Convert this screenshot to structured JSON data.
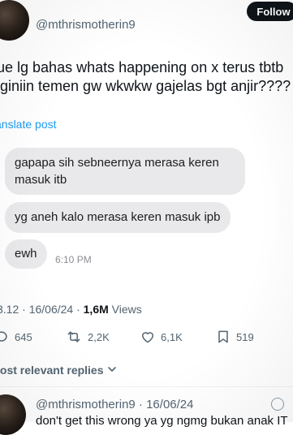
{
  "header": {
    "handle": "@mthrismotherin9",
    "follow_label": "Follow"
  },
  "post": {
    "line1": "ue lg bahas whats happening on x terus tbtb",
    "line2": "iginiin temen gw wkwkw gajelas bgt anjir????",
    "translate": "anslate post"
  },
  "chat": {
    "bubble1_line1": "gapapa sih sebneernya merasa keren",
    "bubble1_line2": "masuk itb",
    "bubble2": "yg aneh kalo merasa keren masuk ipb",
    "bubble3": "ewh",
    "time": "6:10 PM"
  },
  "meta": {
    "time_date": "3.12 · 16/06/24 · ",
    "views_count": "1,6M",
    "views_label": " Views"
  },
  "actions": {
    "replies": "645",
    "reposts": "2,2K",
    "likes": "6,1K",
    "bookmarks": "519"
  },
  "replies_sort": {
    "label": "lost relevant replies"
  },
  "reply_preview": {
    "header": "@mthrismotherin9 · 16/06/24",
    "text": "don't get this wrong ya yg ngmg bukan anak IT"
  },
  "colors": {
    "accent": "#1d9bf0",
    "bubble": "#e9e9eb",
    "muted": "#536471"
  }
}
